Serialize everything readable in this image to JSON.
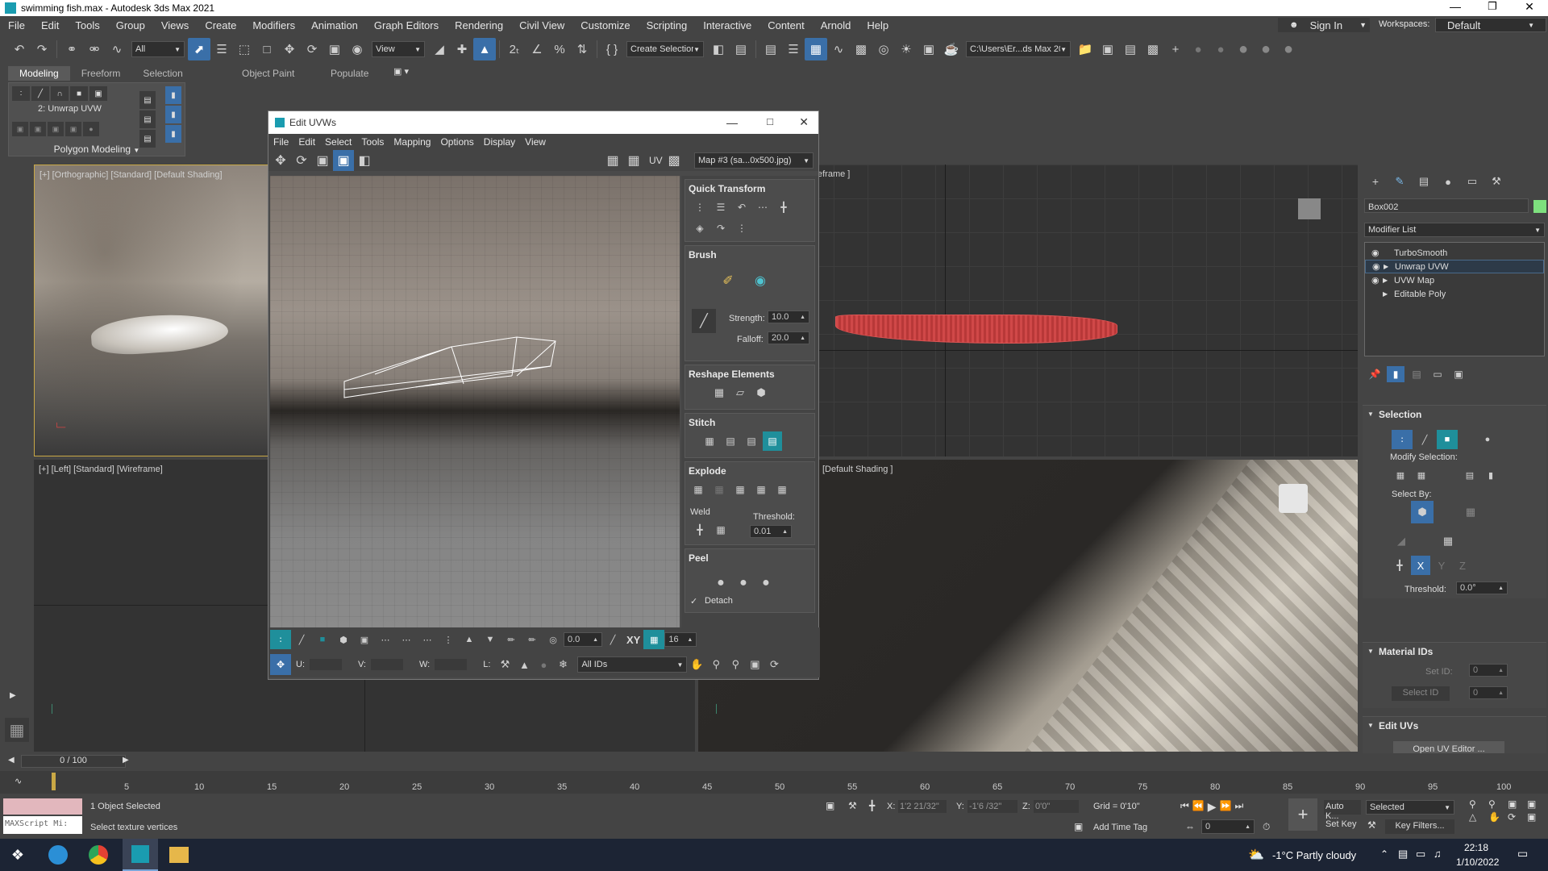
{
  "window": {
    "title": "swimming fish.max - Autodesk 3ds Max 2021"
  },
  "menu": [
    "File",
    "Edit",
    "Tools",
    "Group",
    "Views",
    "Create",
    "Modifiers",
    "Animation",
    "Graph Editors",
    "Rendering",
    "Civil View",
    "Customize",
    "Scripting",
    "Interactive",
    "Content",
    "Arnold",
    "Help"
  ],
  "account": {
    "sign_in": "Sign In",
    "workspaces_label": "Workspaces:",
    "workspace": "Default"
  },
  "toolbar": {
    "filter": "All",
    "ref_coord": "View",
    "selection_set": "Create Selection Se",
    "path": "C:\\Users\\Er...ds Max 202"
  },
  "ribbon": {
    "tabs": [
      "Modeling",
      "Freeform",
      "Selection",
      "Object Paint",
      "Populate"
    ],
    "modifier": "2: Unwrap UVW",
    "group": "Polygon Modeling"
  },
  "viewports": {
    "top_left": "[+] [Orthographic] [Standard] [Default Shading]",
    "bottom_left": "[+] [Left] [Standard] [Wireframe]",
    "top_right": "eframe ]",
    "bottom_right": "[Default Shading ]"
  },
  "edit_uvws": {
    "title": "Edit UVWs",
    "menu": [
      "File",
      "Edit",
      "Select",
      "Tools",
      "Mapping",
      "Options",
      "Display",
      "View"
    ],
    "uv_label": "UV",
    "map": "Map #3 (sa...0x500.jpg)",
    "sections": {
      "quick_transform": "Quick Transform",
      "brush": "Brush",
      "strength_label": "Strength:",
      "strength": "10.0",
      "falloff_label": "Falloff:",
      "falloff": "20.0",
      "reshape": "Reshape Elements",
      "stitch": "Stitch",
      "explode": "Explode",
      "weld": "Weld",
      "threshold_label": "Threshold:",
      "threshold": "0.01",
      "peel": "Peel",
      "detach": "Detach"
    },
    "bottom": {
      "rot": "0.0",
      "xy": "XY",
      "grid": "16",
      "u": "U:",
      "v": "V:",
      "w": "W:",
      "l": "L:",
      "ids": "All IDs"
    }
  },
  "command_panel": {
    "object_name": "Box002",
    "object_color": "#7ee07e",
    "modifier_list": "Modifier List",
    "stack": [
      "TurboSmooth",
      "Unwrap UVW",
      "UVW Map",
      "Editable Poly"
    ],
    "selection": "Selection",
    "modify_selection": "Modify Selection:",
    "select_by": "Select By:",
    "threshold_label": "Threshold:",
    "threshold": "0.0°",
    "material_ids": "Material IDs",
    "set_id": "Set ID:",
    "set_id_value": "0",
    "select_id": "Select ID",
    "select_id_value": "0",
    "edit_uvs": "Edit UVs",
    "open_uv_editor": "Open UV Editor ..."
  },
  "timeline": {
    "frame": "0 / 100",
    "ticks": [
      "5",
      "10",
      "15",
      "20",
      "25",
      "30",
      "35",
      "40",
      "45",
      "50",
      "55",
      "60",
      "65",
      "70",
      "75",
      "80",
      "85",
      "90",
      "95",
      "100"
    ]
  },
  "status": {
    "maxscript": "MAXScript Mi:",
    "selected": "1 Object Selected",
    "prompt": "Select texture vertices",
    "x_label": "X:",
    "x": "1'2 21/32\"",
    "y_label": "Y:",
    "y": "-1'6 /32\"",
    "z_label": "Z:",
    "z": "0'0\"",
    "grid": "Grid = 0'10\"",
    "add_time_tag": "Add Time Tag",
    "auto_key": "Auto K...",
    "set_key": "Set Key",
    "key_mode": "Selected",
    "key_filters": "Key Filters...",
    "frame": "0"
  },
  "taskbar": {
    "weather": "-1°C  Partly cloudy",
    "time": "22:18",
    "date": "1/10/2022"
  }
}
